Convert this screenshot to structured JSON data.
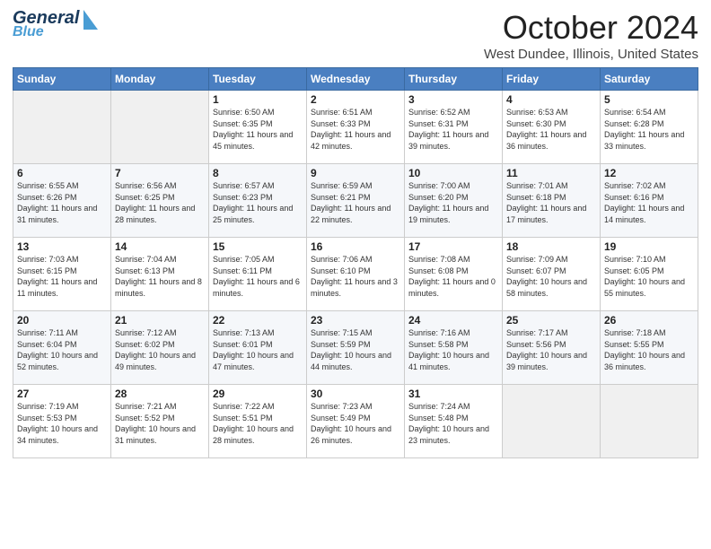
{
  "header": {
    "logo_general": "General",
    "logo_blue": "Blue",
    "month_title": "October 2024",
    "location": "West Dundee, Illinois, United States"
  },
  "weekdays": [
    "Sunday",
    "Monday",
    "Tuesday",
    "Wednesday",
    "Thursday",
    "Friday",
    "Saturday"
  ],
  "weeks": [
    [
      {
        "day": "",
        "info": ""
      },
      {
        "day": "",
        "info": ""
      },
      {
        "day": "1",
        "info": "Sunrise: 6:50 AM\nSunset: 6:35 PM\nDaylight: 11 hours and 45 minutes."
      },
      {
        "day": "2",
        "info": "Sunrise: 6:51 AM\nSunset: 6:33 PM\nDaylight: 11 hours and 42 minutes."
      },
      {
        "day": "3",
        "info": "Sunrise: 6:52 AM\nSunset: 6:31 PM\nDaylight: 11 hours and 39 minutes."
      },
      {
        "day": "4",
        "info": "Sunrise: 6:53 AM\nSunset: 6:30 PM\nDaylight: 11 hours and 36 minutes."
      },
      {
        "day": "5",
        "info": "Sunrise: 6:54 AM\nSunset: 6:28 PM\nDaylight: 11 hours and 33 minutes."
      }
    ],
    [
      {
        "day": "6",
        "info": "Sunrise: 6:55 AM\nSunset: 6:26 PM\nDaylight: 11 hours and 31 minutes."
      },
      {
        "day": "7",
        "info": "Sunrise: 6:56 AM\nSunset: 6:25 PM\nDaylight: 11 hours and 28 minutes."
      },
      {
        "day": "8",
        "info": "Sunrise: 6:57 AM\nSunset: 6:23 PM\nDaylight: 11 hours and 25 minutes."
      },
      {
        "day": "9",
        "info": "Sunrise: 6:59 AM\nSunset: 6:21 PM\nDaylight: 11 hours and 22 minutes."
      },
      {
        "day": "10",
        "info": "Sunrise: 7:00 AM\nSunset: 6:20 PM\nDaylight: 11 hours and 19 minutes."
      },
      {
        "day": "11",
        "info": "Sunrise: 7:01 AM\nSunset: 6:18 PM\nDaylight: 11 hours and 17 minutes."
      },
      {
        "day": "12",
        "info": "Sunrise: 7:02 AM\nSunset: 6:16 PM\nDaylight: 11 hours and 14 minutes."
      }
    ],
    [
      {
        "day": "13",
        "info": "Sunrise: 7:03 AM\nSunset: 6:15 PM\nDaylight: 11 hours and 11 minutes."
      },
      {
        "day": "14",
        "info": "Sunrise: 7:04 AM\nSunset: 6:13 PM\nDaylight: 11 hours and 8 minutes."
      },
      {
        "day": "15",
        "info": "Sunrise: 7:05 AM\nSunset: 6:11 PM\nDaylight: 11 hours and 6 minutes."
      },
      {
        "day": "16",
        "info": "Sunrise: 7:06 AM\nSunset: 6:10 PM\nDaylight: 11 hours and 3 minutes."
      },
      {
        "day": "17",
        "info": "Sunrise: 7:08 AM\nSunset: 6:08 PM\nDaylight: 11 hours and 0 minutes."
      },
      {
        "day": "18",
        "info": "Sunrise: 7:09 AM\nSunset: 6:07 PM\nDaylight: 10 hours and 58 minutes."
      },
      {
        "day": "19",
        "info": "Sunrise: 7:10 AM\nSunset: 6:05 PM\nDaylight: 10 hours and 55 minutes."
      }
    ],
    [
      {
        "day": "20",
        "info": "Sunrise: 7:11 AM\nSunset: 6:04 PM\nDaylight: 10 hours and 52 minutes."
      },
      {
        "day": "21",
        "info": "Sunrise: 7:12 AM\nSunset: 6:02 PM\nDaylight: 10 hours and 49 minutes."
      },
      {
        "day": "22",
        "info": "Sunrise: 7:13 AM\nSunset: 6:01 PM\nDaylight: 10 hours and 47 minutes."
      },
      {
        "day": "23",
        "info": "Sunrise: 7:15 AM\nSunset: 5:59 PM\nDaylight: 10 hours and 44 minutes."
      },
      {
        "day": "24",
        "info": "Sunrise: 7:16 AM\nSunset: 5:58 PM\nDaylight: 10 hours and 41 minutes."
      },
      {
        "day": "25",
        "info": "Sunrise: 7:17 AM\nSunset: 5:56 PM\nDaylight: 10 hours and 39 minutes."
      },
      {
        "day": "26",
        "info": "Sunrise: 7:18 AM\nSunset: 5:55 PM\nDaylight: 10 hours and 36 minutes."
      }
    ],
    [
      {
        "day": "27",
        "info": "Sunrise: 7:19 AM\nSunset: 5:53 PM\nDaylight: 10 hours and 34 minutes."
      },
      {
        "day": "28",
        "info": "Sunrise: 7:21 AM\nSunset: 5:52 PM\nDaylight: 10 hours and 31 minutes."
      },
      {
        "day": "29",
        "info": "Sunrise: 7:22 AM\nSunset: 5:51 PM\nDaylight: 10 hours and 28 minutes."
      },
      {
        "day": "30",
        "info": "Sunrise: 7:23 AM\nSunset: 5:49 PM\nDaylight: 10 hours and 26 minutes."
      },
      {
        "day": "31",
        "info": "Sunrise: 7:24 AM\nSunset: 5:48 PM\nDaylight: 10 hours and 23 minutes."
      },
      {
        "day": "",
        "info": ""
      },
      {
        "day": "",
        "info": ""
      }
    ]
  ]
}
